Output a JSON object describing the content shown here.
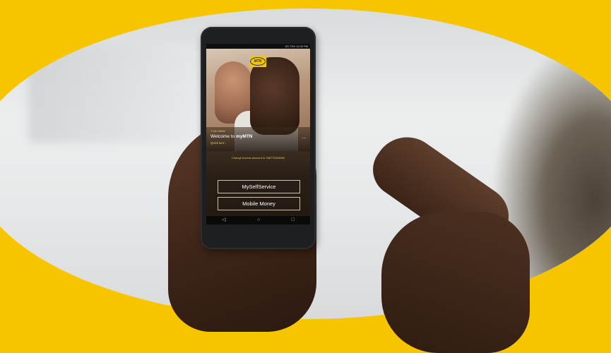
{
  "brand_color": "#f7c500",
  "status_bar": {
    "text": "5G 73% 11:00 PM"
  },
  "app": {
    "logo_text": "MTN",
    "greeting": "Y'ello MMM",
    "welcome_prefix": "Welcome to ",
    "welcome_brand": "myMTN",
    "quick_tour": "Quick tour",
    "more_icon": "more-dots-icon",
    "change_account": "Change Access account to 256775424684",
    "buttons": {
      "self_service": "MySelfService",
      "mobile_money": "Mobile Money"
    },
    "nav": {
      "back": "◁",
      "home": "○",
      "recents": "□"
    }
  }
}
